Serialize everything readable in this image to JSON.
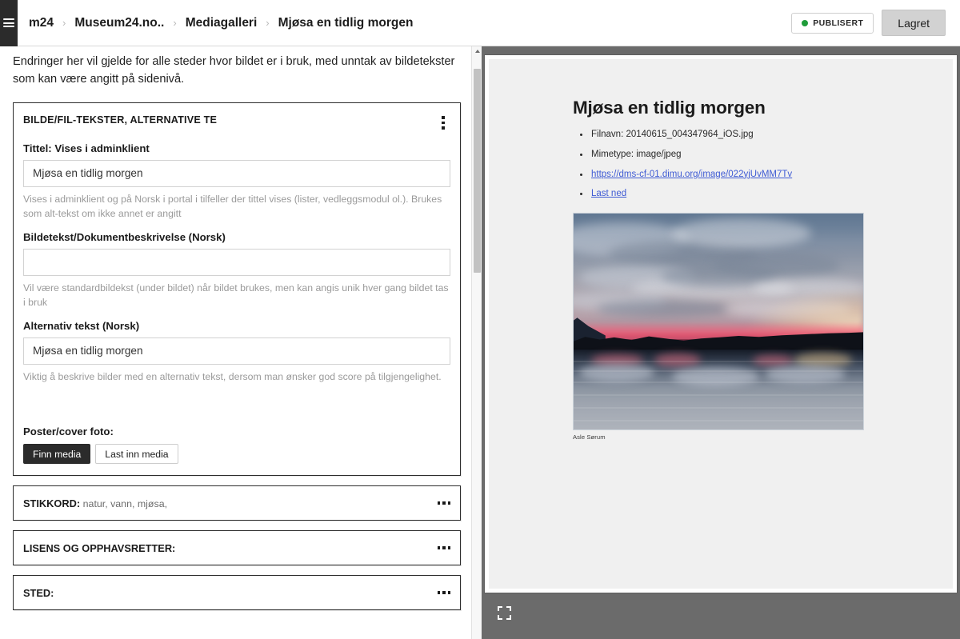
{
  "topbar": {
    "menu_icon": "hamburger-icon",
    "breadcrumbs": [
      {
        "label": "m24"
      },
      {
        "label": "Museum24.no.."
      },
      {
        "label": "Mediagalleri"
      },
      {
        "label": "Mjøsa en tidlig morgen"
      }
    ],
    "separator": "›",
    "publish_status": "PUBLISERT",
    "publish_dot_color": "#1f9c3a",
    "saved_button": "Lagret"
  },
  "editor": {
    "notice": "Endringer her vil gjelde for alle steder hvor bildet er i bruk, med unntak av bildetekster som kan være angitt på sidenivå.",
    "card": {
      "title": "BILDE/FIL-TEKSTER, ALTERNATIVE TE",
      "menu_icon": "kebab-menu-icon",
      "fields": [
        {
          "label": "Tittel: Vises i adminklient",
          "value": "Mjøsa en tidlig morgen",
          "help": "Vises i adminklient og på Norsk i portal i tilfeller der tittel vises (lister, vedleggsmodul ol.). Brukes som alt-tekst om ikke annet er angitt"
        },
        {
          "label": "Bildetekst/Dokumentbeskrivelse (Norsk)",
          "value": "",
          "help": "Vil være standardbildekst (under bildet) når bildet brukes, men kan angis unik hver gang bildet tas i bruk"
        },
        {
          "label": "Alternativ tekst (Norsk)",
          "value": "Mjøsa en tidlig morgen",
          "help": "Viktig å beskrive bilder med en alternativ tekst, dersom man ønsker god score på tilgjengelighet."
        }
      ],
      "poster_label": "Poster/cover foto:",
      "find_media_button": "Finn media",
      "upload_media_button": "Last inn media"
    },
    "accordions": [
      {
        "label": "STIKKORD:",
        "values": "natur, vann, mjøsa,",
        "menu_icon": "ellipsis-icon"
      },
      {
        "label": "LISENS OG OPPHAVSRETTER:",
        "values": "",
        "menu_icon": "ellipsis-icon"
      },
      {
        "label": "STED:",
        "values": "",
        "menu_icon": "ellipsis-icon"
      }
    ]
  },
  "scrollbar": {
    "up_arrow_icon": "chevron-up-icon"
  },
  "preview": {
    "title": "Mjøsa en tidlig morgen",
    "meta": [
      {
        "text": "Filnavn: 20140615_004347964_iOS.jpg",
        "is_link": false
      },
      {
        "text": "Mimetype: image/jpeg",
        "is_link": false
      },
      {
        "text": "https://dms-cf-01.dimu.org/image/022yjUvMM7Tv",
        "is_link": true
      },
      {
        "text": "Last ned",
        "is_link": true
      }
    ],
    "image_alt": "Mjøsa en tidlig morgen",
    "image_caption": "Asle Sørum",
    "link_color": "#3f5bd4",
    "fullscreen_icon": "fullscreen-icon"
  }
}
